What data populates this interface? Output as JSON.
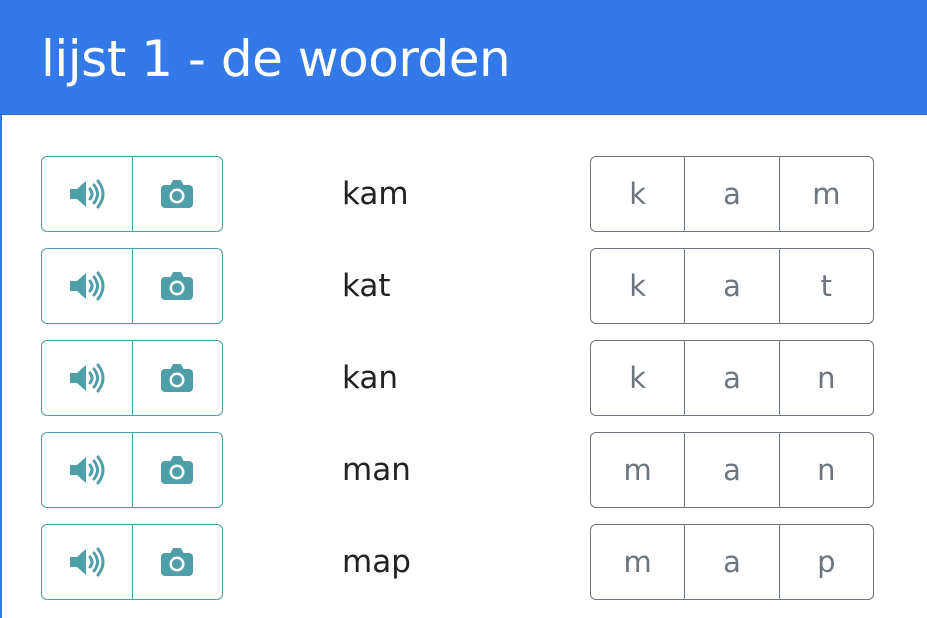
{
  "header": {
    "title": "lijst 1 - de woorden"
  },
  "colors": {
    "header_bg": "#337ae8",
    "icon_color": "#4f9fa9",
    "letter_border": "#6c757d"
  },
  "icons": {
    "sound": "speaker-icon",
    "photo": "camera-icon"
  },
  "rows": [
    {
      "word": "kam",
      "letters": [
        "k",
        "a",
        "m"
      ]
    },
    {
      "word": "kat",
      "letters": [
        "k",
        "a",
        "t"
      ]
    },
    {
      "word": "kan",
      "letters": [
        "k",
        "a",
        "n"
      ]
    },
    {
      "word": "man",
      "letters": [
        "m",
        "a",
        "n"
      ]
    },
    {
      "word": "map",
      "letters": [
        "m",
        "a",
        "p"
      ]
    }
  ]
}
